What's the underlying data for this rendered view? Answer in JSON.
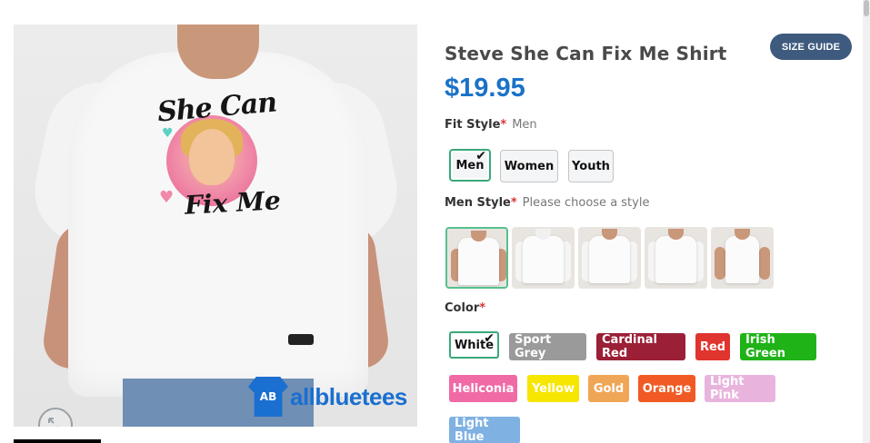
{
  "product": {
    "title": "Steve She Can Fix Me Shirt",
    "price": "$19.95",
    "size_guide_label": "SIZE GUIDE",
    "image_print_line1": "She Can",
    "image_print_line2": "Fix Me",
    "watermark_text": "allbluetees",
    "watermark_logo": "AB"
  },
  "fit_style": {
    "label": "Fit Style",
    "required_mark": "*",
    "selected_value": "Men",
    "options": [
      "Men",
      "Women",
      "Youth"
    ],
    "selected_index": 0
  },
  "men_style": {
    "label": "Men Style",
    "required_mark": "*",
    "placeholder": "Please choose a style",
    "thumbnails": [
      "t-shirt",
      "hoodie",
      "sweatshirt",
      "long-sleeve",
      "tank-top"
    ],
    "selected_index": 0
  },
  "color": {
    "label": "Color",
    "required_mark": "*",
    "selected_index": 0,
    "options": [
      {
        "name": "White",
        "hex": "#ffffff"
      },
      {
        "name": "Sport Grey",
        "hex": "#9a9a9a"
      },
      {
        "name": "Cardinal Red",
        "hex": "#9b1f36"
      },
      {
        "name": "Red",
        "hex": "#e0342f"
      },
      {
        "name": "Irish Green",
        "hex": "#1fb317"
      },
      {
        "name": "Heliconia",
        "hex": "#f06aa6"
      },
      {
        "name": "Yellow",
        "hex": "#f7e600"
      },
      {
        "name": "Gold",
        "hex": "#f0a657"
      },
      {
        "name": "Orange",
        "hex": "#f15a24"
      },
      {
        "name": "Light Pink",
        "hex": "#e8b4dd"
      },
      {
        "name": "Light Blue",
        "hex": "#7fb1e2"
      }
    ]
  },
  "icons": {
    "zoom": "zoom-expand-icon",
    "check": "check-icon"
  }
}
